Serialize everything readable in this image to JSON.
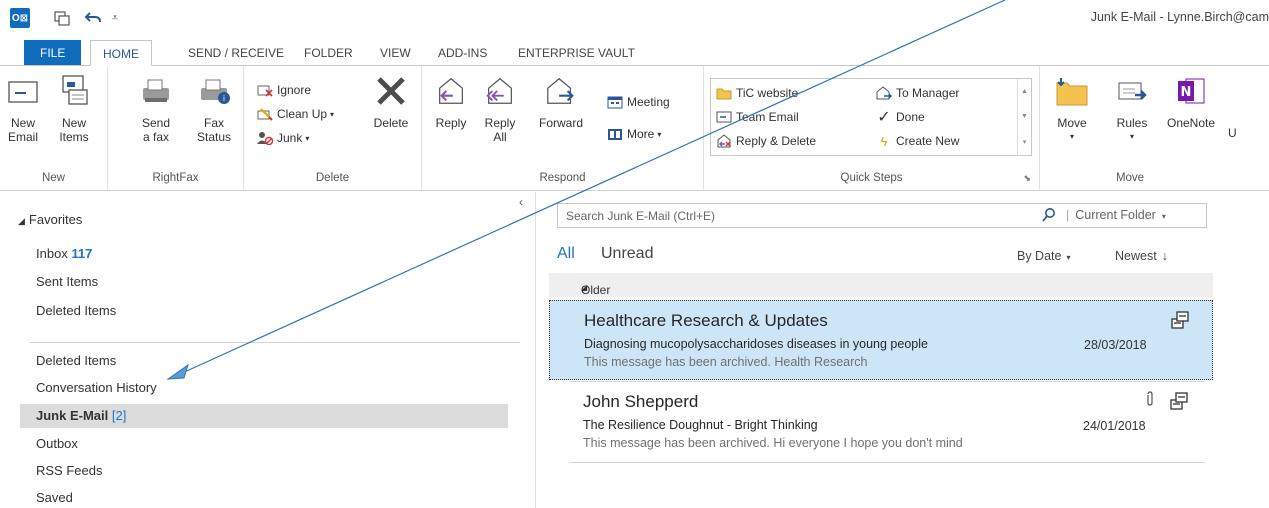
{
  "window": {
    "title": "Junk E-Mail - Lynne.Birch@cam",
    "quick_access": [
      "outlook-app-icon",
      "send-receive-all-icon",
      "undo-icon",
      "customize-toolbar-icon"
    ]
  },
  "tabs": [
    {
      "label": "FILE"
    },
    {
      "label": "HOME"
    },
    {
      "label": "SEND / RECEIVE"
    },
    {
      "label": "FOLDER"
    },
    {
      "label": "VIEW"
    },
    {
      "label": "ADD-INS"
    },
    {
      "label": "ENTERPRISE VAULT"
    }
  ],
  "ribbon": {
    "new": {
      "label": "New",
      "new_email": "New Email",
      "new_items": "New Items"
    },
    "rightfax": {
      "label": "RightFax",
      "send_fax": "Send a fax",
      "fax_status": "Fax Status"
    },
    "delete": {
      "label": "Delete",
      "ignore": "Ignore",
      "clean_up": "Clean Up",
      "junk": "Junk",
      "delete": "Delete"
    },
    "respond": {
      "label": "Respond",
      "reply": "Reply",
      "reply_all": "Reply All",
      "forward": "Forward",
      "meeting": "Meeting",
      "more": "More"
    },
    "quick_steps": {
      "label": "Quick Steps",
      "items": [
        "TiC website",
        "Team Email",
        "Reply & Delete",
        "To Manager",
        "Done",
        "Create New"
      ]
    },
    "move": {
      "label": "Move",
      "move": "Move",
      "rules": "Rules",
      "onenote": "OneNote"
    }
  },
  "nav": {
    "favorites": "Favorites",
    "inbox": {
      "label": "Inbox",
      "count": "117"
    },
    "sent": "Sent Items",
    "deleted_fav": "Deleted Items",
    "deleted": "Deleted Items",
    "conversation": "Conversation History",
    "junk": {
      "label": "Junk E-Mail",
      "count": "[2]"
    },
    "outbox": "Outbox",
    "rss": "RSS Feeds",
    "saved": "Saved"
  },
  "search": {
    "placeholder": "Search Junk E-Mail (Ctrl+E)",
    "scope": "Current Folder"
  },
  "filters": {
    "all": "All",
    "unread": "Unread",
    "by_date": "By Date",
    "newest": "Newest"
  },
  "group_header": "Older",
  "messages": [
    {
      "from": "Healthcare Research & Updates",
      "subject": "Diagnosing mucopolysaccharidoses diseases in young people",
      "preview": "This message has been archived.  Health Research",
      "date": "28/03/2018",
      "selected": true,
      "attachment": false
    },
    {
      "from": "John Shepperd",
      "subject": "The Resilience Doughnut - Bright Thinking",
      "preview": "This message has been archived.  Hi everyone  I hope you don't mind",
      "date": "24/01/2018",
      "selected": false,
      "attachment": true
    }
  ],
  "colors": {
    "accent": "#0f6cbd",
    "link": "#1f74c4",
    "selection": "#cde6f7",
    "nav_selection": "#dcdcdc"
  }
}
